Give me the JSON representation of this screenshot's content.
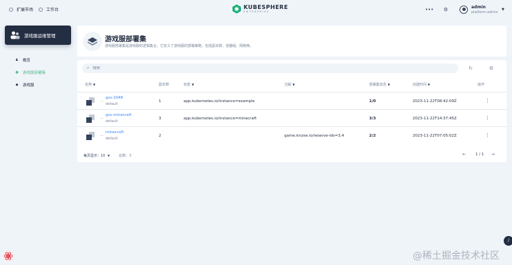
{
  "topbar": {
    "marketplace_label": "扩展市场",
    "workbench_label": "工作台",
    "logo_title": "KUBESPHERE",
    "logo_subtitle": "ENTERPRISE",
    "user_name": "admin",
    "user_role": "platform-admin"
  },
  "sidebar": {
    "title": "游戏服运维管理",
    "items": [
      {
        "label": "概览",
        "active": false
      },
      {
        "label": "游戏服部署集",
        "active": true
      },
      {
        "label": "游戏服",
        "active": false
      }
    ]
  },
  "banner": {
    "title": "游戏服部署集",
    "description": "游戏服部署集是游戏服的逻辑集合，它定义了游戏服的部署策略，包括副本数、容器组、网络等。"
  },
  "table": {
    "search_placeholder": "搜索",
    "columns": {
      "name": "名称",
      "replicas": "副本数",
      "labels": "标签",
      "annotations": "注解",
      "status": "部署集状态",
      "created": "创建时间",
      "actions": "操作"
    },
    "rows": [
      {
        "name": "gss-2048",
        "namespace": "default",
        "replicas": "1",
        "label": "app.kubernetes.io/instance=example",
        "annotation": "",
        "status": "1/0",
        "created": "2023-11-22T08:42:09Z"
      },
      {
        "name": "gss-minecraft",
        "namespace": "default",
        "replicas": "3",
        "label": "app.kubernetes.io/instance=minecraft",
        "annotation": "",
        "status": "3/3",
        "created": "2023-11-22T14:37:45Z"
      },
      {
        "name": "minecraft",
        "namespace": "default",
        "replicas": "2",
        "label": "",
        "annotation": "game.kruise.io/reserve-ids=3,4",
        "status": "2/2",
        "created": "2023-11-22T07:05:02Z"
      }
    ],
    "row_dash": "—",
    "more_glyph": "⋮",
    "page_size_label": "每页显示：10",
    "total_label": "总数：3",
    "pagination": "1 / 1"
  },
  "watermark": "@稀土掘金技术社区",
  "colors": {
    "accent": "#55bc8a",
    "link": "#3385ff",
    "dark": "#242e42",
    "bg": "#eff4f9"
  }
}
